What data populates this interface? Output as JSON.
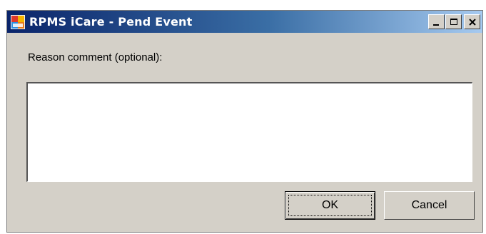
{
  "window": {
    "title": "RPMS iCare - Pend Event",
    "app_icon": "rpms-icare-app-icon",
    "caption_buttons": {
      "minimize_icon": "minimize-icon",
      "maximize_icon": "maximize-icon",
      "close_icon": "close-icon"
    }
  },
  "form": {
    "comment_label": "Reason comment (optional):",
    "comment_value": ""
  },
  "buttons": {
    "ok_label": "OK",
    "cancel_label": "Cancel"
  }
}
